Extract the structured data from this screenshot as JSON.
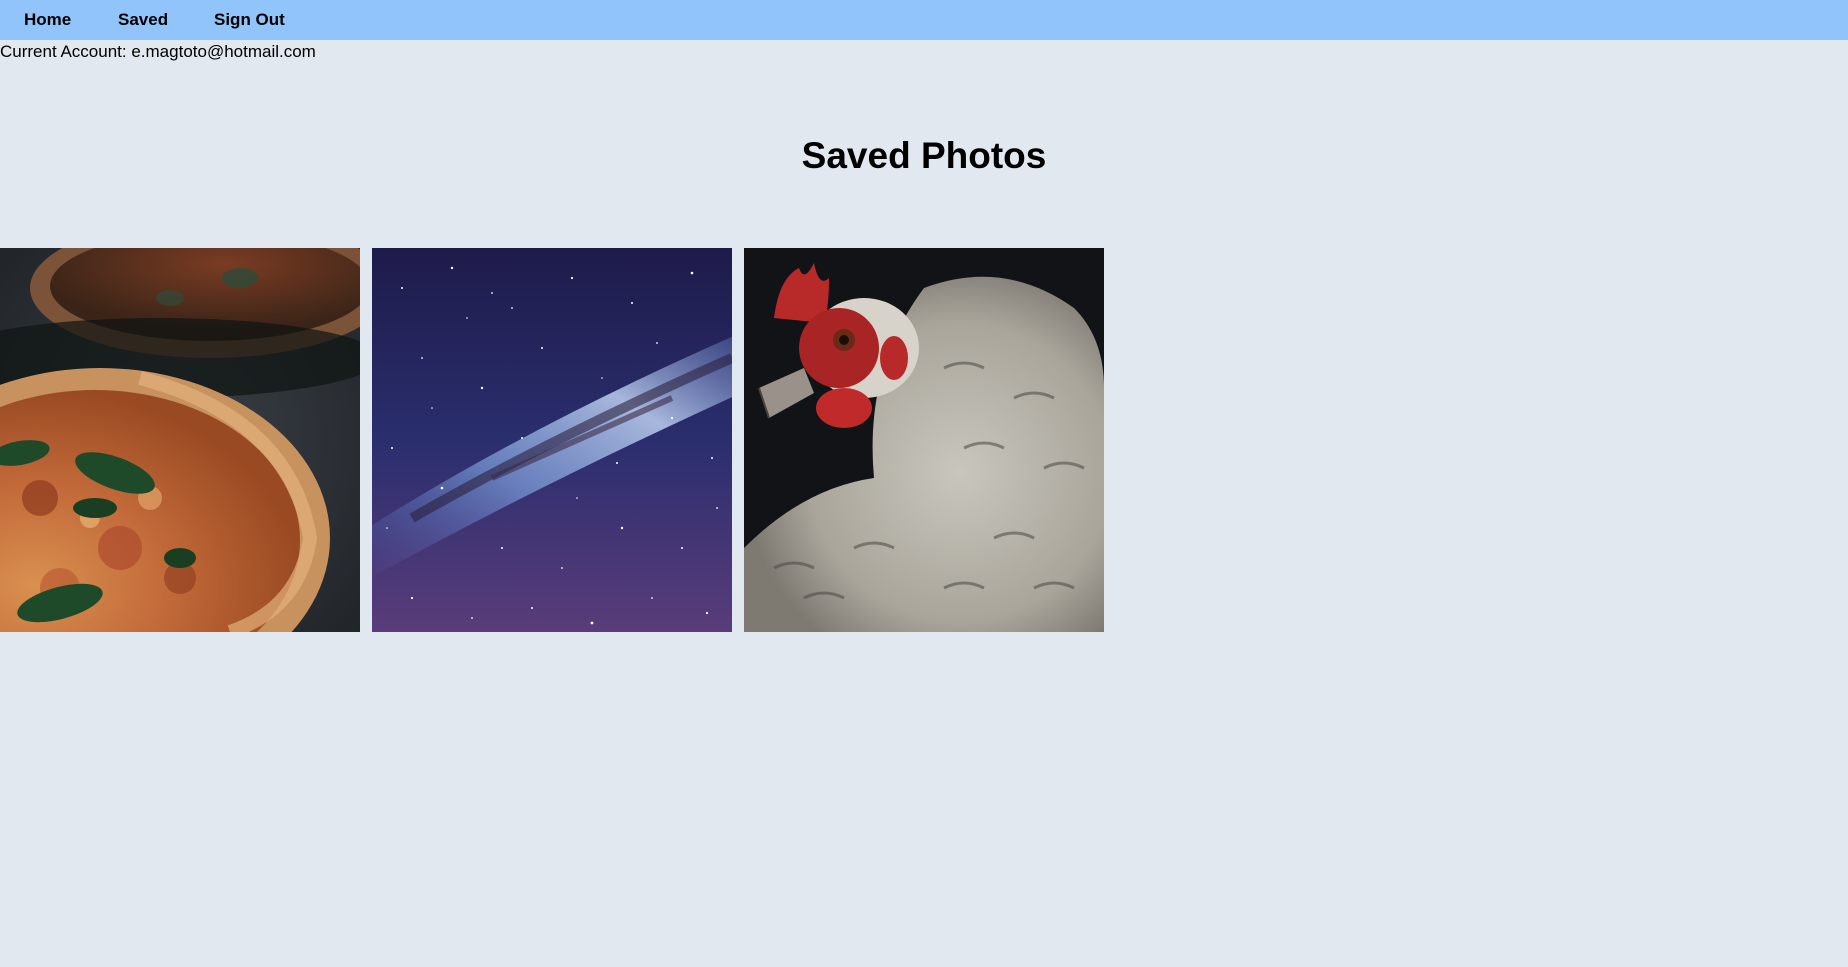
{
  "nav": {
    "items": [
      {
        "label": "Home"
      },
      {
        "label": "Saved"
      },
      {
        "label": "Sign Out"
      }
    ]
  },
  "account": {
    "text": "Current Account: e.magtoto@hotmail.com"
  },
  "page": {
    "title": "Saved Photos"
  },
  "photos": [
    {
      "subject": "pizza"
    },
    {
      "subject": "milky way galaxy"
    },
    {
      "subject": "chicken"
    }
  ],
  "colors": {
    "navbar": "#90c4fb",
    "background": "#e2e8f0"
  }
}
